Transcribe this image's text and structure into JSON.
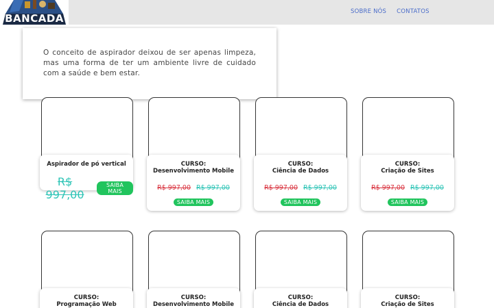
{
  "header": {
    "logo_text": "BANCADA",
    "nav": [
      "SOBRE NÓS",
      "CONTATOS"
    ]
  },
  "intro": {
    "text": "O conceito de aspirador deixou de ser apenas limpeza, mas uma forma de ter um ambiente livre de cuidado com a saúde e bem estar."
  },
  "cards_row1": [
    {
      "title1": "Aspirador de pó vertical",
      "title2": "",
      "old_price": "",
      "new_price": "R$ 997,00",
      "button": "SAIBA MAIS"
    },
    {
      "title1": "CURSO:",
      "title2": "Desenvolvimento Mobile",
      "old_price": "R$ 997,00",
      "new_price": "R$ 997,00",
      "button": "SAIBA MAIS"
    },
    {
      "title1": "CURSO:",
      "title2": "Ciência de Dados",
      "old_price": "R$ 997,00",
      "new_price": "R$ 997,00",
      "button": "SAIBA MAIS"
    },
    {
      "title1": "CURSO:",
      "title2": "Criação de Sites",
      "old_price": "R$ 997,00",
      "new_price": "R$ 997,00",
      "button": "SAIBA MAIS"
    }
  ],
  "cards_row2": [
    {
      "title1": "CURSO:",
      "title2": "Programação Web"
    },
    {
      "title1": "CURSO:",
      "title2": "Desenvolvimento Mobile"
    },
    {
      "title1": "CURSO:",
      "title2": "Ciência de Dados"
    },
    {
      "title1": "CURSO:",
      "title2": "Criação de Sites"
    }
  ],
  "colors": {
    "header_bg": "#e6e6e6",
    "nav_link": "#4a6cc9",
    "old_price": "#d9333f",
    "new_price": "#2ec4b6",
    "button": "#21c45d"
  }
}
